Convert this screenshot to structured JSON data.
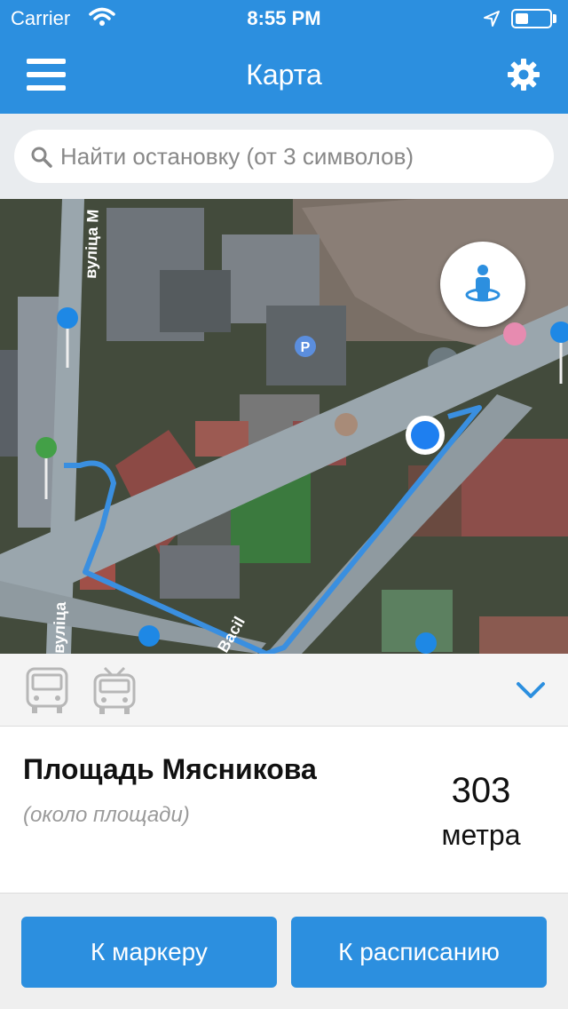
{
  "status_bar": {
    "carrier": "Carrier",
    "time": "8:55 PM",
    "battery_level": 0.4
  },
  "nav": {
    "title": "Карта",
    "menu_icon": "hamburger-menu-icon",
    "settings_icon": "gear-icon"
  },
  "search": {
    "placeholder": "Найти остановку (от 3 символов)",
    "value": ""
  },
  "map": {
    "street_labels": [
      "вуліца М",
      "Васіl",
      "вуліца"
    ],
    "parking_label": "P",
    "locate_icon": "person-location-icon"
  },
  "transport": {
    "modes": [
      "bus-icon",
      "trolleybus-icon"
    ],
    "expand_icon": "chevron-down-icon"
  },
  "stop": {
    "name": "Площадь Мясникова",
    "subtitle": "(около площади)",
    "distance_value": "303",
    "distance_unit": "метра"
  },
  "buttons": {
    "to_marker": "К маркеру",
    "to_schedule": "К расписанию"
  },
  "colors": {
    "accent": "#2c8fdf",
    "route": "#3a8fe0",
    "marker_blue": "#1e88e5",
    "marker_green": "#43a047"
  }
}
